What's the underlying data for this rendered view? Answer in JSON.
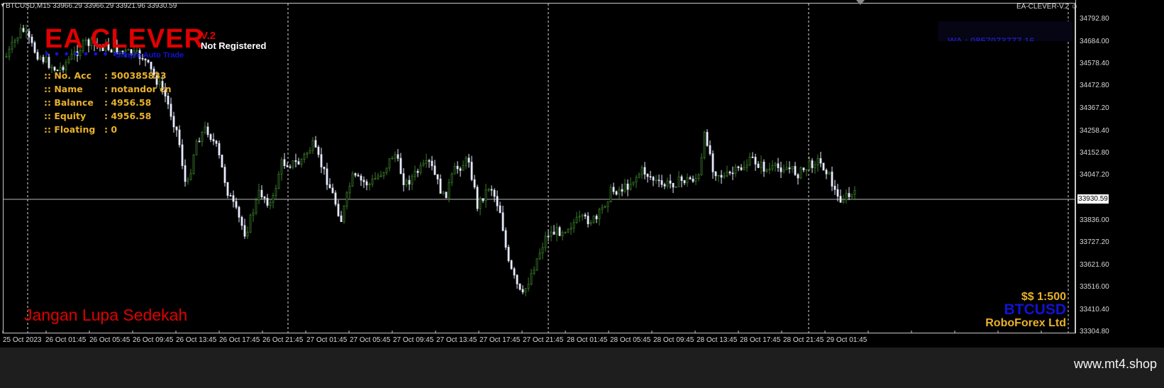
{
  "header": {
    "symbol_ohlc": "BTCUSD,M15  33966.29 33966.29 33921.96 33930.59",
    "indicator_name": "EA-CLEVER-V.2 ☺"
  },
  "logo": {
    "title": "EA CLEVER",
    "version": "V.2",
    "registration": "Not Registered",
    "subtitle": "Simple Auto Trade"
  },
  "account_info": [
    {
      "label": ":: No. Acc",
      "value": ": 500385833"
    },
    {
      "label": ":: Name",
      "value": ": notandor cn"
    },
    {
      "label": ":: Balance",
      "value": ": 4956.58"
    },
    {
      "label": ":: Equity",
      "value": ": 4956.58"
    },
    {
      "label": ":: Floating",
      "value": ": 0"
    }
  ],
  "contact": {
    "whatsapp": "WA : 0857073777 16"
  },
  "footer_text": {
    "reminder": "Jangan Lupa Sedekah",
    "leverage": "$$ 1:500",
    "symbol": "BTCUSD",
    "broker": "RoboForex Ltd"
  },
  "watermark": "www.mt4.shop",
  "price_axis": {
    "labels": [
      "34792.80",
      "34684.00",
      "34578.40",
      "34472.80",
      "34367.20",
      "34258.40",
      "34152.80",
      "34047.20",
      "33836.00",
      "33727.20",
      "33621.60",
      "33516.00",
      "33410.40",
      "33304.80"
    ],
    "current_price": "33930.59"
  },
  "time_axis": {
    "labels": [
      "25 Oct 2023",
      "26 Oct 01:45",
      "26 Oct 05:45",
      "26 Oct 09:45",
      "26 Oct 13:45",
      "26 Oct 17:45",
      "26 Oct 21:45",
      "27 Oct 01:45",
      "27 Oct 05:45",
      "27 Oct 09:45",
      "27 Oct 13:45",
      "27 Oct 17:45",
      "27 Oct 21:45",
      "28 Oct 01:45",
      "28 Oct 05:45",
      "28 Oct 09:45",
      "28 Oct 13:45",
      "28 Oct 17:45",
      "28 Oct 21:45",
      "29 Oct 01:45"
    ]
  },
  "colors": {
    "bull_candle": "#3a7d2a",
    "bear_candle": "#e8ecff",
    "background": "#000000",
    "grid": "#c8c8c8"
  }
}
